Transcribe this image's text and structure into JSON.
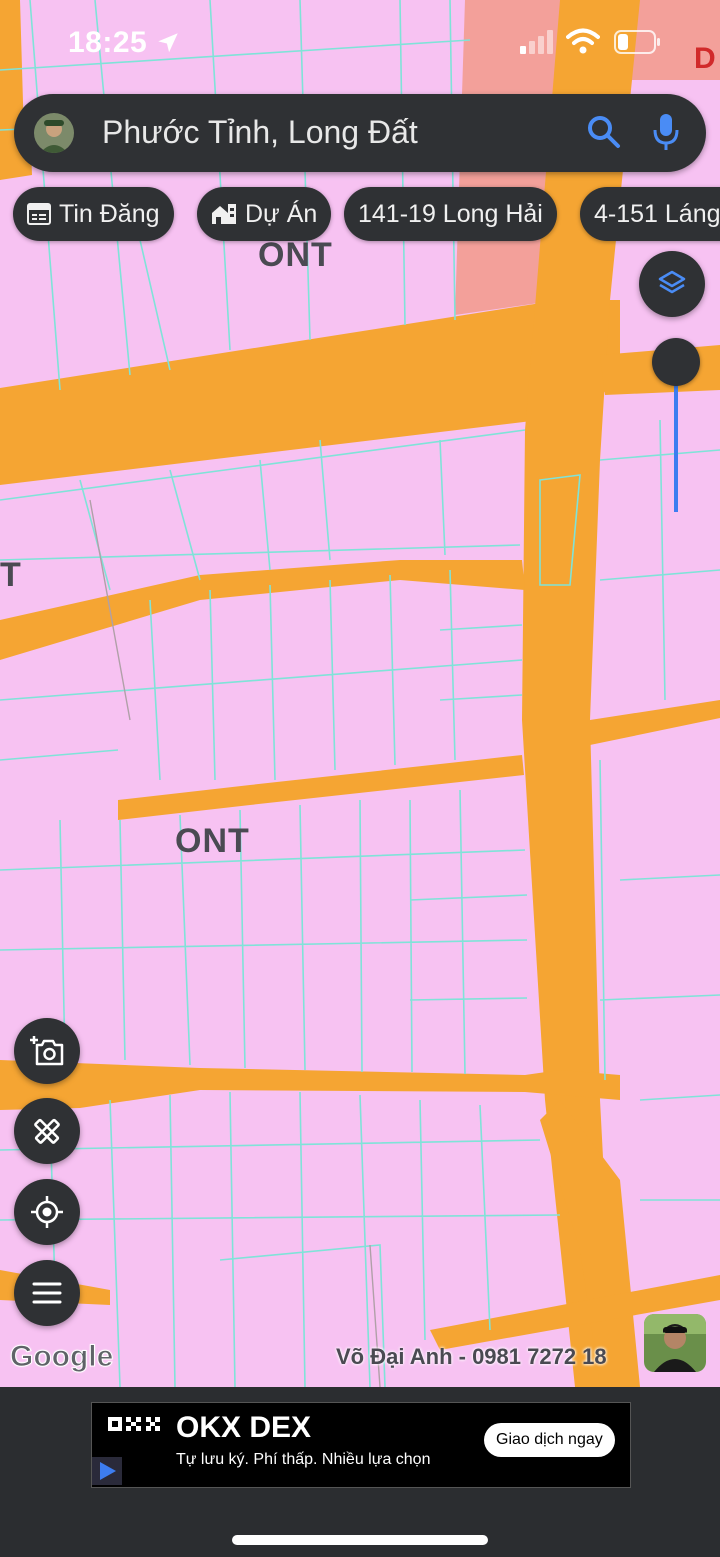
{
  "status_bar": {
    "time": "18:25"
  },
  "search": {
    "text": "Phước Tỉnh, Long Đất"
  },
  "chips": [
    {
      "label": "Tin Đăng",
      "icon": "listing-icon"
    },
    {
      "label": "Dự Án",
      "icon": "building-icon"
    },
    {
      "label": "141-19 Long Hải",
      "icon": ""
    },
    {
      "label": "4-151 Láng",
      "icon": ""
    }
  ],
  "map": {
    "labels": [
      "ONT",
      "ONT",
      "T"
    ],
    "attribution": "Google",
    "watermark": "Võ Đại Anh - 0981 7272 18",
    "corner_letter": "D"
  },
  "controls": [
    "layers-icon",
    "camera-add-icon",
    "ruler-tools-icon",
    "my-location-icon",
    "menu-icon"
  ],
  "ad": {
    "brand": "OKX DEX",
    "subtitle": "Tự lưu ký. Phí thấp. Nhiều lựa chọn",
    "cta": "Giao dịch ngay"
  },
  "colors": {
    "land": "#f7c2f2",
    "road": "#f5a533",
    "commercial": "#f3a09a",
    "parcel_line": "#7fe3d8",
    "ui_dark": "#2f3134",
    "accent": "#3d7df0"
  }
}
